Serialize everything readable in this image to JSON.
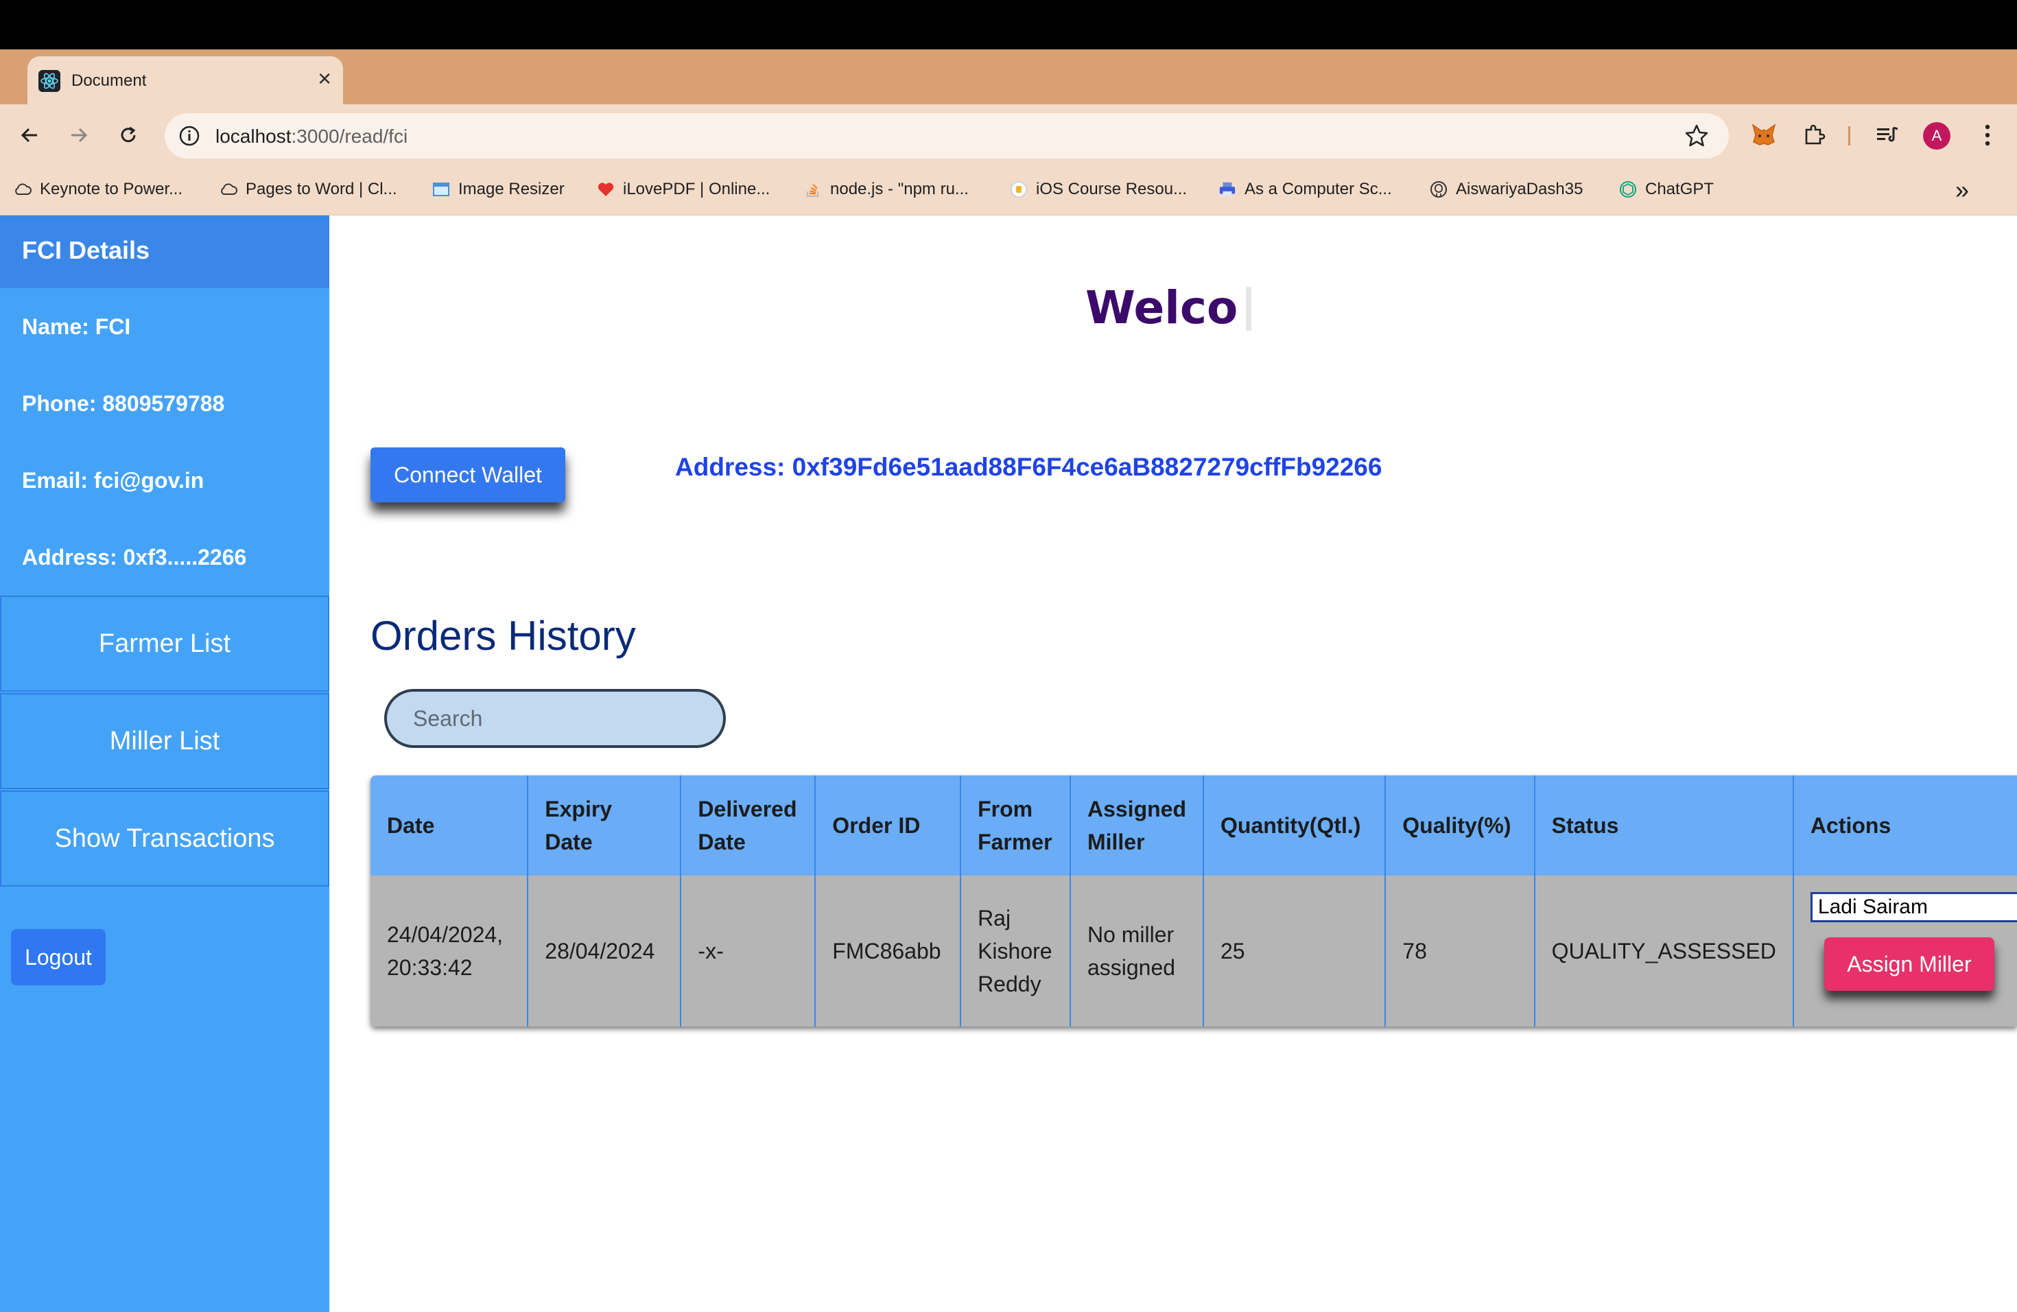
{
  "browser": {
    "tab_title": "Document",
    "new_tab": "+",
    "url_host": "localhost",
    "url_path": ":3000/read/fci",
    "avatar_letter": "A",
    "bookmarks": [
      {
        "label": "Keynote to Power...",
        "icon": "cloud-icon"
      },
      {
        "label": "Pages to Word | Cl...",
        "icon": "cloud-icon"
      },
      {
        "label": "Image Resizer",
        "icon": "image-icon"
      },
      {
        "label": "iLovePDF | Online...",
        "icon": "heart-icon"
      },
      {
        "label": "node.js - \"npm ru...",
        "icon": "stackoverflow-icon"
      },
      {
        "label": "iOS Course Resou...",
        "icon": "course-icon"
      },
      {
        "label": "As a Computer Sc...",
        "icon": "printer-icon"
      },
      {
        "label": "AiswariyaDash35",
        "icon": "github-icon"
      },
      {
        "label": "ChatGPT",
        "icon": "chatgpt-icon"
      }
    ],
    "more": "»"
  },
  "sidebar": {
    "title": "FCI Details",
    "name": "Name: FCI",
    "phone": "Phone: 8809579788",
    "email": "Email: fci@gov.in",
    "address": "Address: 0xf3.....2266",
    "buttons": [
      "Farmer List",
      "Miller List",
      "Show Transactions"
    ],
    "logout": "Logout"
  },
  "main": {
    "welcome": "Welco",
    "connect_wallet": "Connect Wallet",
    "wallet_address": "Address: 0xf39Fd6e51aad88F6F4ce6aB8827279cffFb92266",
    "orders_title": "Orders History",
    "search_placeholder": "Search"
  },
  "table": {
    "headers": [
      "Date",
      "Expiry Date",
      "Delivered Date",
      "Order ID",
      "From Farmer",
      "Assigned Miller",
      "Quantity(Qtl.)",
      "Quality(%)",
      "Status",
      "Actions"
    ],
    "rows": [
      {
        "date": "24/04/2024, 20:33:42",
        "expiry": "28/04/2024",
        "delivered": "-x-",
        "order_id": "FMC86abb",
        "farmer": "Raj Kishore Reddy",
        "miller": "No miller assigned",
        "quantity": "25",
        "quality": "78",
        "status": "QUALITY_ASSESSED",
        "selected_miller": "Ladi Sairam",
        "assign_label": "Assign Miller"
      }
    ]
  },
  "colors": {
    "sidebar": "#45a3f7",
    "sidebar_header": "#3a87e8",
    "connect_button": "#3478f0",
    "assign_button": "#e8306b",
    "welcome_text": "#3b0a6b",
    "address_text": "#1f43e6"
  }
}
